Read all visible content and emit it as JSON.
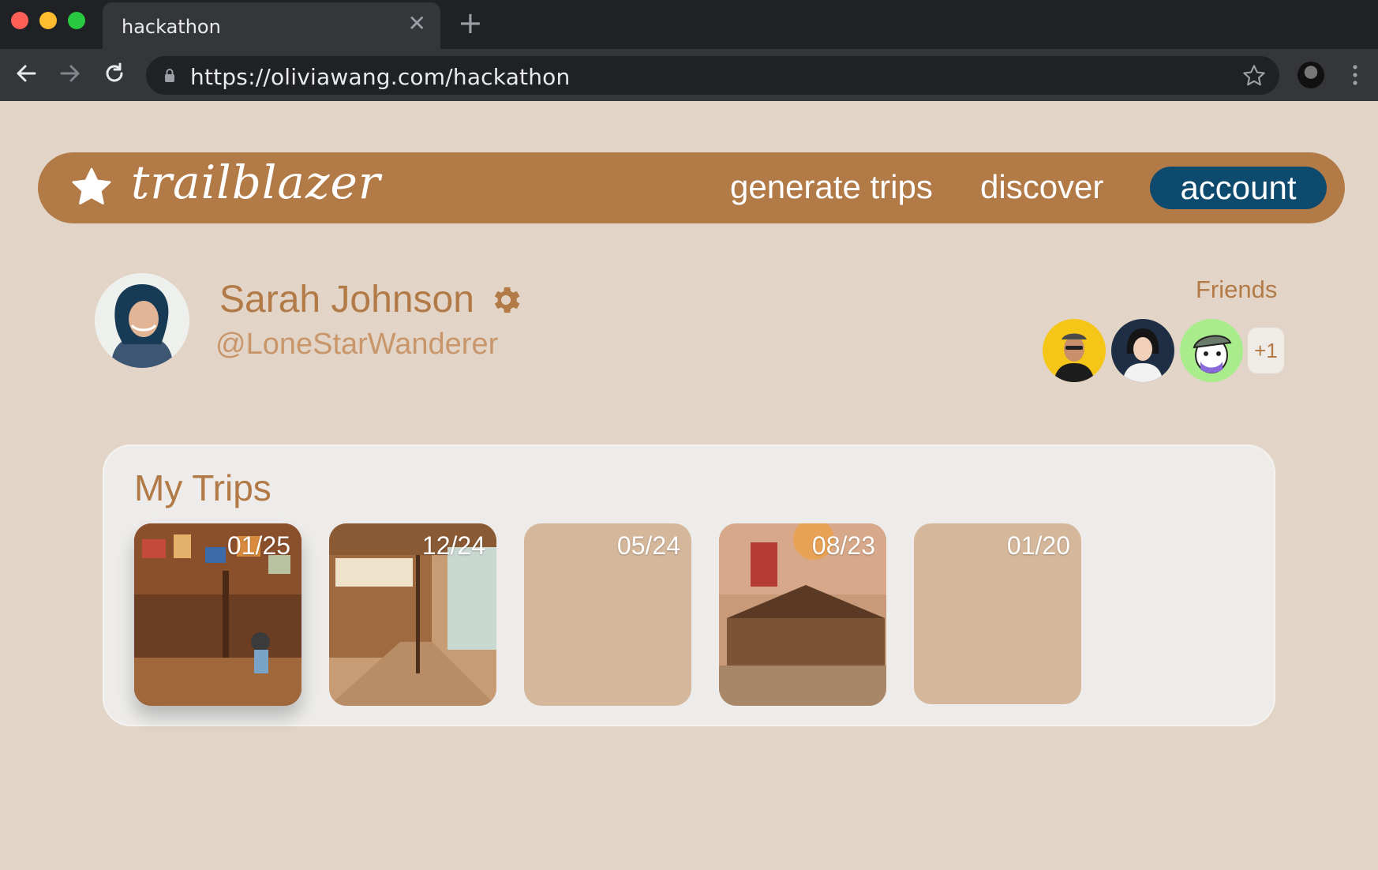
{
  "browser": {
    "tab_title": "hackathon",
    "url": "https://oliviawang.com/hackathon",
    "traffic_colors": [
      "#ff5f57",
      "#febc2e",
      "#28c840"
    ]
  },
  "navbar": {
    "logo_text": "trailblazer",
    "links": [
      "generate trips",
      "discover"
    ],
    "active_link": "account",
    "bar_color": "#b27a47",
    "active_color": "#0d4a6e"
  },
  "profile": {
    "name": "Sarah Johnson",
    "handle": "@LoneStarWanderer"
  },
  "friends": {
    "label": "Friends",
    "more": "+1"
  },
  "trips": {
    "title": "My Trips",
    "cards": [
      {
        "date": "01/25",
        "has_photo": true
      },
      {
        "date": "12/24",
        "has_photo": true
      },
      {
        "date": "05/24",
        "has_photo": false
      },
      {
        "date": "08/23",
        "has_photo": true
      },
      {
        "date": "01/20",
        "has_photo": false
      }
    ]
  }
}
